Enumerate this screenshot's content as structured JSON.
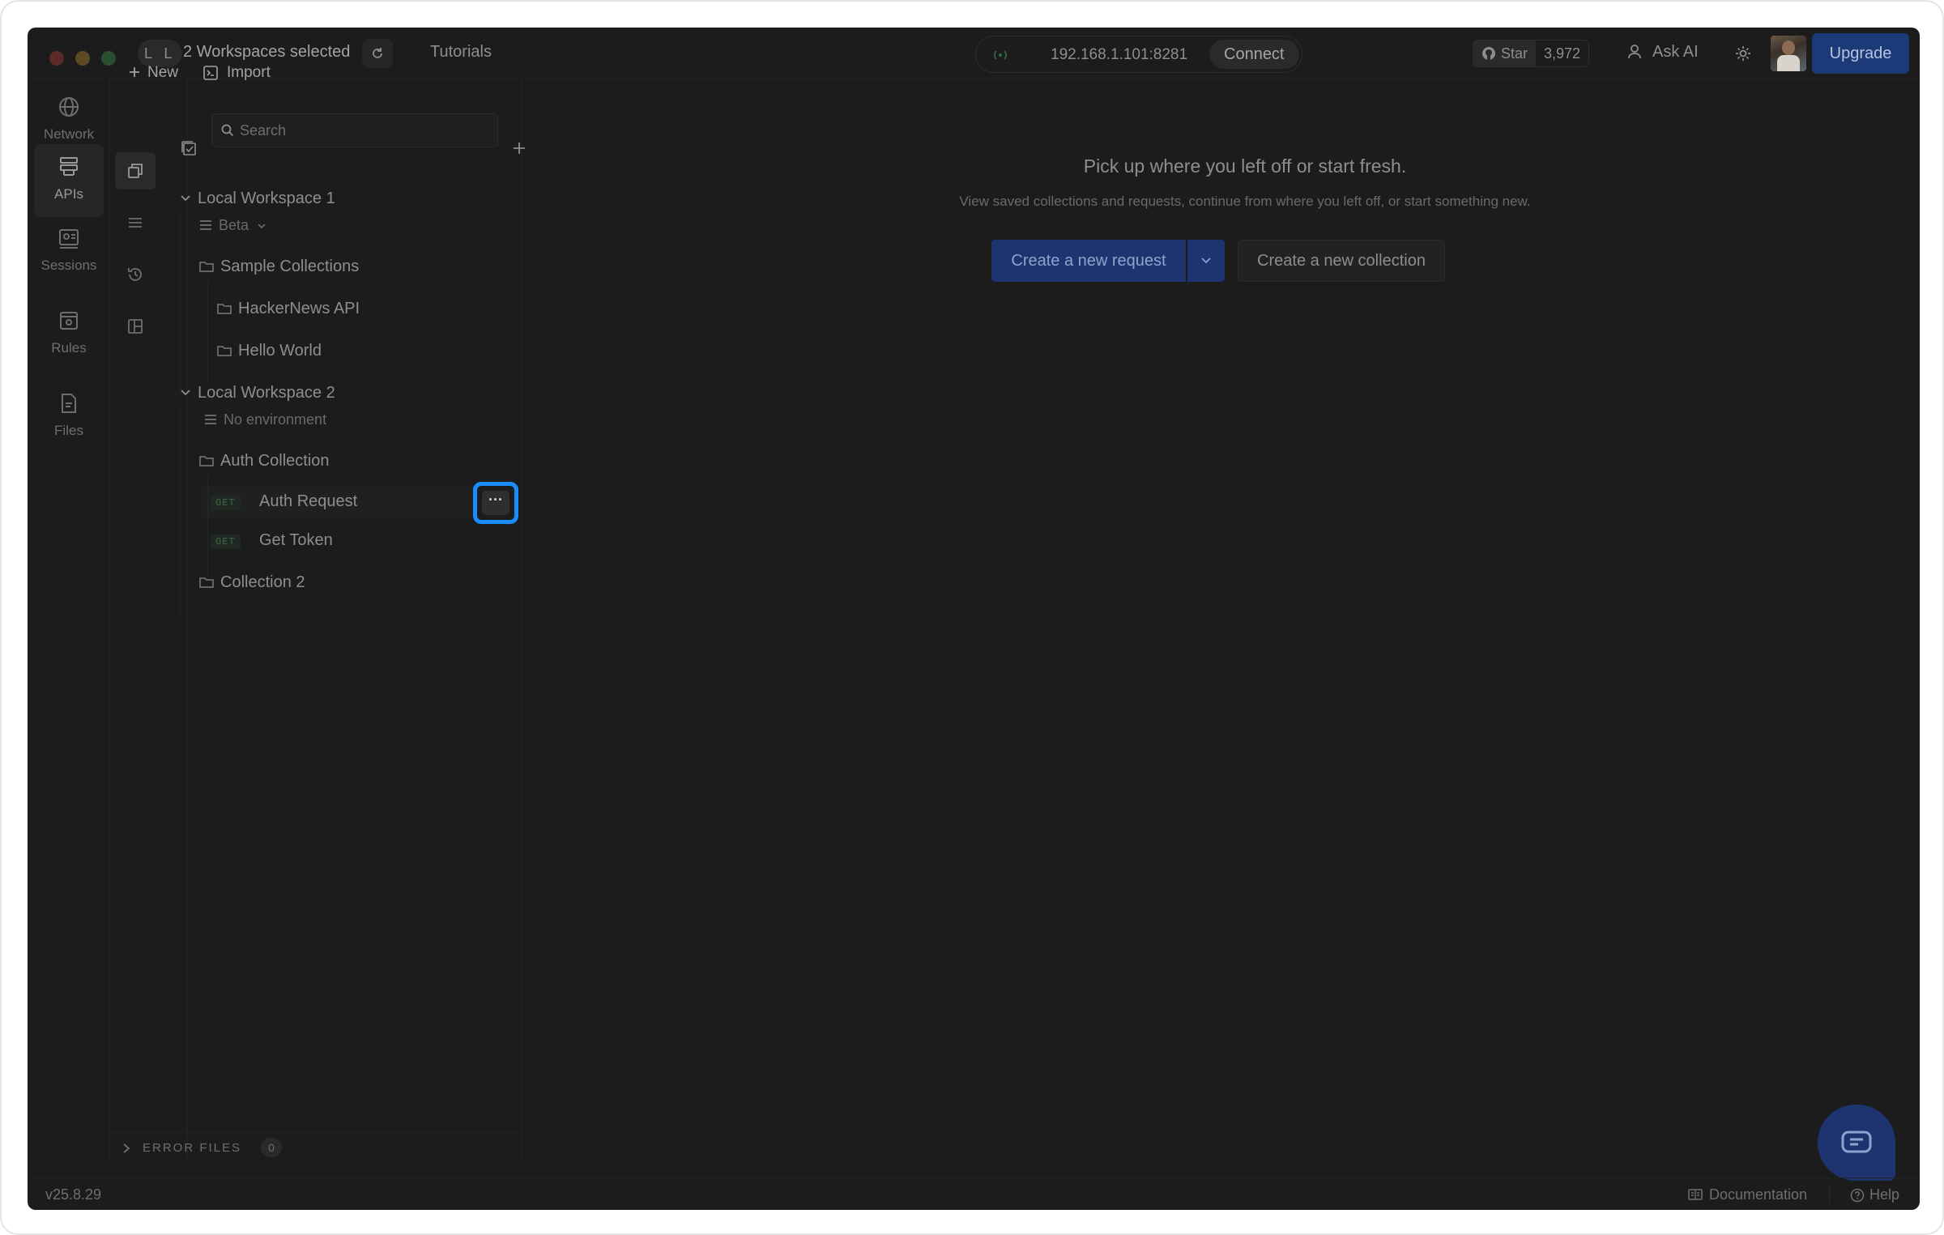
{
  "topbar": {
    "workspace_initials": "L L",
    "workspace_label": "2 Workspaces selected",
    "tutorials": "Tutorials",
    "connection_ip": "192.168.1.101:8281",
    "connect_label": "Connect",
    "star_label": "Star",
    "star_count": "3,972",
    "ask_ai": "Ask AI",
    "upgrade": "Upgrade"
  },
  "rail": {
    "items": [
      {
        "label": "Network",
        "icon": "globe-icon"
      },
      {
        "label": "APIs",
        "icon": "api-icon",
        "active": true
      },
      {
        "label": "Sessions",
        "icon": "sessions-icon"
      },
      {
        "label": "Rules",
        "icon": "rules-icon"
      },
      {
        "label": "Files",
        "icon": "files-icon"
      }
    ]
  },
  "toolbar": {
    "new_label": "New",
    "import_label": "Import",
    "search_placeholder": "Search"
  },
  "tree": {
    "workspace1": {
      "name": "Local Workspace 1",
      "environment": "Beta",
      "collections": [
        {
          "name": "Sample Collections"
        },
        {
          "name": "HackerNews API"
        },
        {
          "name": "Hello World"
        }
      ]
    },
    "workspace2": {
      "name": "Local Workspace 2",
      "environment": "No environment",
      "collection": "Auth Collection",
      "requests": [
        {
          "method": "GET",
          "name": "Auth Request"
        },
        {
          "method": "GET",
          "name": "Get Token"
        }
      ],
      "collection2": "Collection 2"
    },
    "more_label": "···"
  },
  "error_files": {
    "label": "ERROR FILES",
    "count": "0"
  },
  "main": {
    "title": "Pick up where you left off or start fresh.",
    "subtitle": "View saved collections and requests, continue from where you left off, or start something new.",
    "create_request": "Create a new request",
    "create_collection": "Create a new collection"
  },
  "footer": {
    "version": "v25.8.29",
    "documentation": "Documentation",
    "help": "Help"
  },
  "colors": {
    "highlight": "#1a8cff",
    "primary": "#1d3470",
    "background": "#1c1c1d"
  }
}
